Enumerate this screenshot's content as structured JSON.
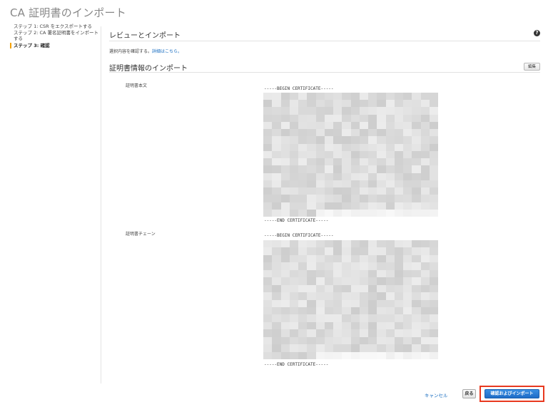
{
  "page": {
    "title": "CA 証明書のインポート"
  },
  "steps": [
    {
      "label": "ステップ 1: CSR をエクスポートする"
    },
    {
      "label": "ステップ 2: CA 署名証明書をインポートする"
    },
    {
      "label": "ステップ 3: 確認"
    }
  ],
  "review": {
    "title": "レビューとインポート",
    "description": "選択内容を確認する。",
    "link_text": "詳細はこちら。",
    "help_icon": "question-circle-icon"
  },
  "certificate_info": {
    "title": "証明書情報のインポート",
    "edit_label": "編集",
    "body_label": "証明書本文",
    "chain_label": "証明書チェーン",
    "begin_marker": "-----BEGIN CERTIFICATE-----",
    "end_marker": "-----END CERTIFICATE-----",
    "content_state": "pixelated-redacted"
  },
  "footer": {
    "cancel_label": "キャンセル",
    "back_label": "戻る",
    "confirm_label": "確認およびインポート"
  },
  "colors": {
    "accent": "#f4a100",
    "link": "#1a6ec1",
    "primary_button": "#1e6cc6",
    "highlight": "#e8391f"
  }
}
